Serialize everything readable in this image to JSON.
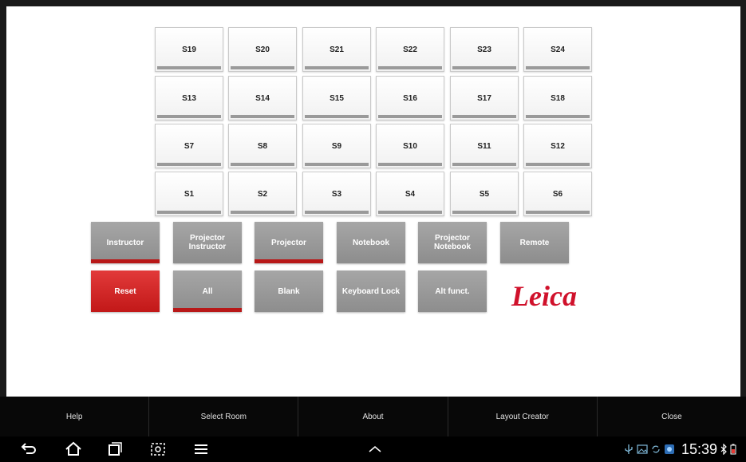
{
  "seats": {
    "row1": [
      "S19",
      "S20",
      "S21",
      "S22",
      "S23",
      "S24"
    ],
    "row2": [
      "S13",
      "S14",
      "S15",
      "S16",
      "S17",
      "S18"
    ],
    "row3": [
      "S7",
      "S8",
      "S9",
      "S10",
      "S11",
      "S12"
    ],
    "row4": [
      "S1",
      "S2",
      "S3",
      "S4",
      "S5",
      "S6"
    ]
  },
  "controls": {
    "row1": [
      {
        "label": "Instructor",
        "active": true
      },
      {
        "label": "Projector\nInstructor",
        "active": false
      },
      {
        "label": "Projector",
        "active": true
      },
      {
        "label": "Notebook",
        "active": false
      },
      {
        "label": "Projector\nNotebook",
        "active": false
      },
      {
        "label": "Remote",
        "active": false
      }
    ],
    "row2": [
      {
        "label": "Reset",
        "active": false
      },
      {
        "label": "All",
        "active": true
      },
      {
        "label": "Blank",
        "active": false
      },
      {
        "label": "Keyboard Lock",
        "active": false
      },
      {
        "label": "Alt funct.",
        "active": false
      }
    ]
  },
  "logo": {
    "text": "Leica",
    "color": "#d0112b"
  },
  "action_bar": [
    "Help",
    "Select Room",
    "About",
    "Layout Creator",
    "Close"
  ],
  "status_bar": {
    "time": "15:39"
  },
  "colors": {
    "active_indicator": "#b81818",
    "reset": "#d42a2a",
    "button_gray": "#999999"
  }
}
